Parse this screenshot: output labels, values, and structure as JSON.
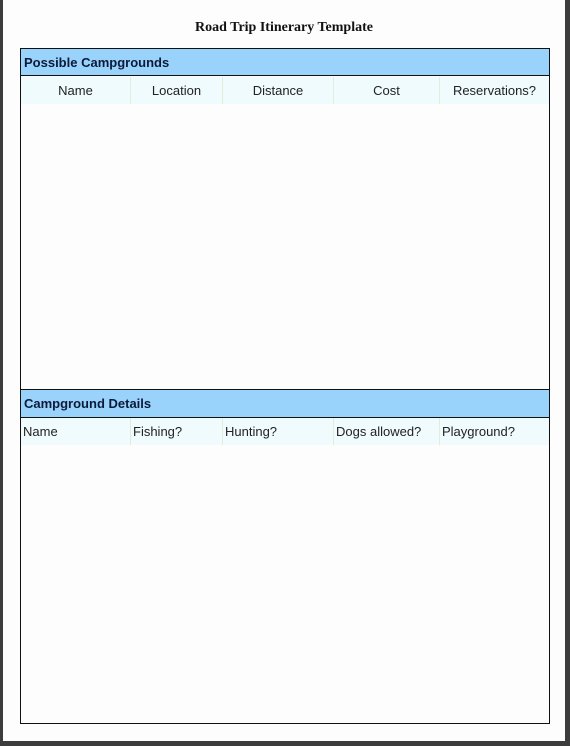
{
  "title": "Road Trip Itinerary Template",
  "sections": [
    {
      "header": "Possible Campgrounds",
      "columns": [
        "Name",
        "Location",
        "Distance",
        "Cost",
        "Reservations?"
      ],
      "rows": []
    },
    {
      "header": "Campground Details",
      "columns": [
        "Name",
        "Fishing?",
        "Hunting?",
        "Dogs allowed?",
        "Playground?"
      ],
      "rows": []
    }
  ],
  "colors": {
    "section_header_bg": "#99d3fb",
    "column_header_bg": "#f0fbfe",
    "frame": "#3c3c3c"
  }
}
